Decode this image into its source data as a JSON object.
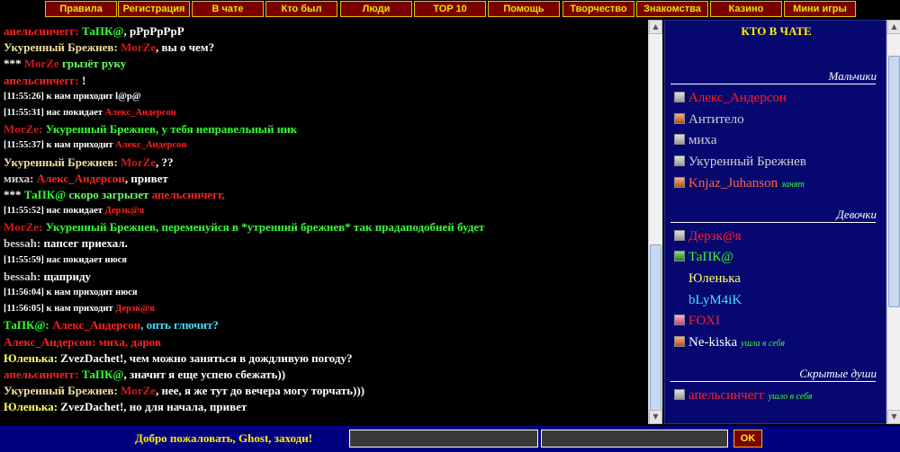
{
  "nav": [
    {
      "label": "Правила"
    },
    {
      "label": "Регистрация"
    },
    {
      "label": "В чате"
    },
    {
      "label": "Кто был"
    },
    {
      "label": "Люди"
    },
    {
      "label": "TOP 10"
    },
    {
      "label": "Помощь"
    },
    {
      "label": "Творчество"
    },
    {
      "label": "Знакомства"
    },
    {
      "label": "Казино"
    },
    {
      "label": "Мини игры"
    }
  ],
  "chat": {
    "messages": [
      {
        "segments": [
          {
            "t": "апельсинчегг:",
            "c": "c-red"
          },
          {
            "t": " ТаПК@",
            "c": "c-green"
          },
          {
            "t": ", pPpPpPpP",
            "c": "c-white"
          }
        ]
      },
      {
        "segments": [
          {
            "t": "Укуренный Брежнев:",
            "c": "c-beige"
          },
          {
            "t": " MorZe",
            "c": "c-dred"
          },
          {
            "t": ", вы о чем?",
            "c": "c-white"
          }
        ]
      },
      {
        "segments": [
          {
            "t": "*** ",
            "c": "c-white"
          },
          {
            "t": "MorZe",
            "c": "c-dred"
          },
          {
            "t": " грызёт руку",
            "c": "c-lgreen"
          }
        ]
      },
      {
        "segments": [
          {
            "t": "апельсинчегг:",
            "c": "c-red"
          },
          {
            "t": " !",
            "c": "c-white"
          }
        ]
      },
      {
        "sys": true,
        "segments": [
          {
            "t": "[11:55:26] к нам приходит l@p@",
            "c": "c-white"
          }
        ]
      },
      {
        "sys": true,
        "segments": [
          {
            "t": "[11:55:31] нас покидает ",
            "c": "c-white"
          },
          {
            "t": "Алекс_Андерсон",
            "c": "c-red"
          }
        ]
      },
      {
        "segments": [
          {
            "t": "MorZe:",
            "c": "c-dred"
          },
          {
            "t": " Укуренный Брежнев, у тебя неправельный ник",
            "c": "c-green"
          }
        ]
      },
      {
        "sys": true,
        "segments": [
          {
            "t": "[11:55:37] к нам приходит ",
            "c": "c-white"
          },
          {
            "t": "Алекс_Андерсон",
            "c": "c-red"
          }
        ]
      },
      {
        "segments": [
          {
            "t": "Укуренный Брежнев:",
            "c": "c-beige"
          },
          {
            "t": " MorZe",
            "c": "c-dred"
          },
          {
            "t": ", ??",
            "c": "c-white"
          }
        ]
      },
      {
        "segments": [
          {
            "t": "миха:",
            "c": "c-gray"
          },
          {
            "t": " Алекс_Андерсон",
            "c": "c-red"
          },
          {
            "t": ", привет",
            "c": "c-white"
          }
        ]
      },
      {
        "segments": [
          {
            "t": "*** ",
            "c": "c-white"
          },
          {
            "t": "ТаПК@",
            "c": "c-green"
          },
          {
            "t": " скоро загрызет ",
            "c": "c-lgreen"
          },
          {
            "t": "апельсинчегг,",
            "c": "c-red"
          }
        ]
      },
      {
        "sys": true,
        "segments": [
          {
            "t": "[11:55:52] нас покидает ",
            "c": "c-white"
          },
          {
            "t": "Дерзк@я",
            "c": "c-red"
          }
        ]
      },
      {
        "segments": [
          {
            "t": "MorZe:",
            "c": "c-dred"
          },
          {
            "t": " Укуренный Брежнев, переменуйся в *утренний брежнев* так прадаподобней будет",
            "c": "c-green"
          }
        ]
      },
      {
        "segments": [
          {
            "t": "bessah:",
            "c": "c-gray"
          },
          {
            "t": " папсег приехал.",
            "c": "c-white"
          }
        ]
      },
      {
        "sys": true,
        "segments": [
          {
            "t": "[11:55:59] нас покидает нюся",
            "c": "c-white"
          }
        ]
      },
      {
        "segments": [
          {
            "t": "bessah:",
            "c": "c-gray"
          },
          {
            "t": " щаприду",
            "c": "c-white"
          }
        ]
      },
      {
        "sys": true,
        "segments": [
          {
            "t": "[11:56:04] к нам приходит нюся",
            "c": "c-white"
          }
        ]
      },
      {
        "sys": true,
        "segments": [
          {
            "t": "[11:56:05] к нам приходит ",
            "c": "c-white"
          },
          {
            "t": "Дерзк@я",
            "c": "c-red"
          }
        ]
      },
      {
        "segments": [
          {
            "t": "ТаПК@:",
            "c": "c-green"
          },
          {
            "t": " Алекс_Андерсон",
            "c": "c-red"
          },
          {
            "t": ", опть глючит?",
            "c": "c-cyan"
          }
        ]
      },
      {
        "segments": [
          {
            "t": "Алекс_Андерсон:",
            "c": "c-red"
          },
          {
            "t": " миха, даров",
            "c": "c-red"
          }
        ]
      },
      {
        "segments": [
          {
            "t": "Юленька:",
            "c": "c-yellow"
          },
          {
            "t": " ZvezDachet!, чем можно заняться в дождливую погоду?",
            "c": "c-white"
          }
        ]
      },
      {
        "segments": [
          {
            "t": "апельсинчегг:",
            "c": "c-red"
          },
          {
            "t": " ТаПК@",
            "c": "c-green"
          },
          {
            "t": ", значит я еще успею сбежать))",
            "c": "c-white"
          }
        ]
      },
      {
        "segments": [
          {
            "t": "Укуренный Брежнев:",
            "c": "c-beige"
          },
          {
            "t": " MorZe",
            "c": "c-dred"
          },
          {
            "t": ", нее, я же тут до вечера могу торчать)))",
            "c": "c-white"
          }
        ]
      },
      {
        "segments": [
          {
            "t": "Юленька:",
            "c": "c-yellow"
          },
          {
            "t": " ZvezDachet!, но для начала, привет",
            "c": "c-white"
          }
        ]
      }
    ]
  },
  "users": {
    "title": "КТО В ЧАТЕ",
    "groups": [
      {
        "title": "Мальчики",
        "members": [
          {
            "name": "Алекс_Андерсон",
            "color": "#ff2020",
            "icon": "info-icon",
            "status": ""
          },
          {
            "name": "Антитело",
            "color": "#d0d0d0",
            "icon": "book-icon",
            "status": ""
          },
          {
            "name": "миха",
            "color": "#d0d0d0",
            "icon": "info-icon",
            "status": ""
          },
          {
            "name": "Укуренный Брежнев",
            "color": "#d0d0d0",
            "icon": "info-icon",
            "status": ""
          },
          {
            "name": "Knjaz_Juhanson",
            "color": "#ff6633",
            "icon": "book-icon",
            "status": "занят"
          }
        ]
      },
      {
        "title": "Девочки",
        "members": [
          {
            "name": "Дерзк@я",
            "color": "#ff2020",
            "icon": "info-icon",
            "status": ""
          },
          {
            "name": "ТаПК@",
            "color": "#33ff33",
            "icon": "ginfo-icon",
            "status": ""
          },
          {
            "name": "Юленька",
            "color": "#ffff66",
            "icon": "",
            "status": ""
          },
          {
            "name": "bLyM4iK",
            "color": "#40e0ff",
            "icon": "",
            "status": ""
          },
          {
            "name": "FOXI",
            "color": "#ff2020",
            "icon": "pink-icon",
            "status": ""
          },
          {
            "name": "Ne-kiska",
            "color": "#ffffff",
            "icon": "book-icon",
            "status": "ушла в себя"
          }
        ]
      },
      {
        "title": "Скрытые души",
        "members": [
          {
            "name": "апельсинчегг",
            "color": "#ff2020",
            "icon": "info-icon",
            "status": "ушло в себя"
          }
        ]
      }
    ]
  },
  "bottom": {
    "welcome": "Добро пожаловать, Ghost, заходи!",
    "ok_label": "OK",
    "input_value": "",
    "input2_value": ""
  }
}
